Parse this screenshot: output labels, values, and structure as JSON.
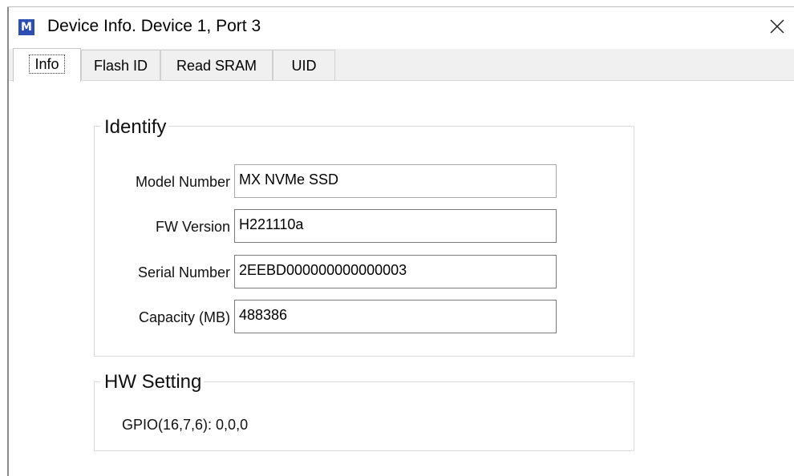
{
  "window": {
    "title": "Device Info. Device 1, Port 3",
    "app_icon_letter": "M",
    "accent_color": "#2d4fb3"
  },
  "tabs": [
    {
      "label": "Info",
      "active": true
    },
    {
      "label": "Flash ID",
      "active": false
    },
    {
      "label": "Read SRAM",
      "active": false
    },
    {
      "label": "UID",
      "active": false
    }
  ],
  "identify": {
    "title": "Identify",
    "fields": [
      {
        "label": "Model Number",
        "value": "MX NVMe SSD"
      },
      {
        "label": "FW Version",
        "value": "H221110a"
      },
      {
        "label": "Serial Number",
        "value": "2EEBD000000000000003"
      },
      {
        "label": "Capacity (MB)",
        "value": "488386"
      }
    ]
  },
  "hw_setting": {
    "title": "HW Setting",
    "gpio_text": "GPIO(16,7,6): 0,0,0"
  },
  "icons": {
    "app": "app-logo-icon",
    "close": "close-icon"
  }
}
